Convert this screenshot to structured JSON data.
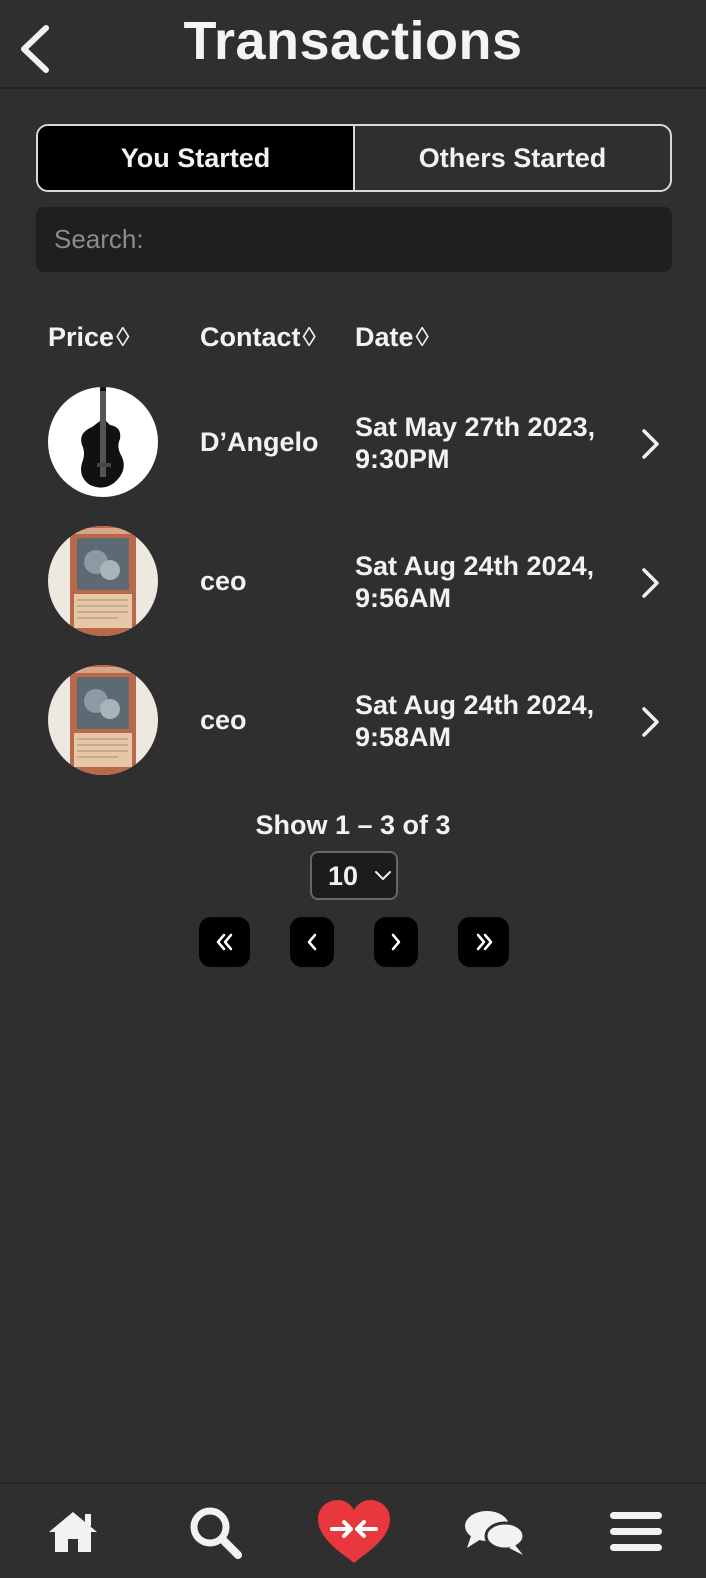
{
  "header": {
    "title": "Transactions",
    "back_icon": "chevron-left-icon"
  },
  "tabs": [
    {
      "label": "You Started",
      "active": true
    },
    {
      "label": "Others Started",
      "active": false
    }
  ],
  "search": {
    "placeholder": "Search:",
    "value": ""
  },
  "table": {
    "columns": [
      {
        "label": "Price",
        "sort_icon": "◊"
      },
      {
        "label": "Contact",
        "sort_icon": "◊"
      },
      {
        "label": "Date",
        "sort_icon": "◊"
      }
    ],
    "rows": [
      {
        "thumbnail": "guitar-image",
        "contact": "D’Angelo",
        "date": "Sat May 27th 2023, 9:30PM"
      },
      {
        "thumbnail": "trading-card-image",
        "contact": "ceo",
        "date": "Sat Aug 24th 2024, 9:56AM"
      },
      {
        "thumbnail": "trading-card-image",
        "contact": "ceo",
        "date": "Sat Aug 24th 2024, 9:58AM"
      }
    ]
  },
  "pagination": {
    "summary": "Show 1 – 3 of 3",
    "page_size": "10",
    "buttons": [
      "first-page-icon",
      "prev-page-icon",
      "next-page-icon",
      "last-page-icon"
    ]
  },
  "bottom_nav": {
    "items": [
      "home-icon",
      "search-icon",
      "heart-swap-icon",
      "chat-icon",
      "menu-icon"
    ],
    "accent_color": "#e8383d"
  }
}
